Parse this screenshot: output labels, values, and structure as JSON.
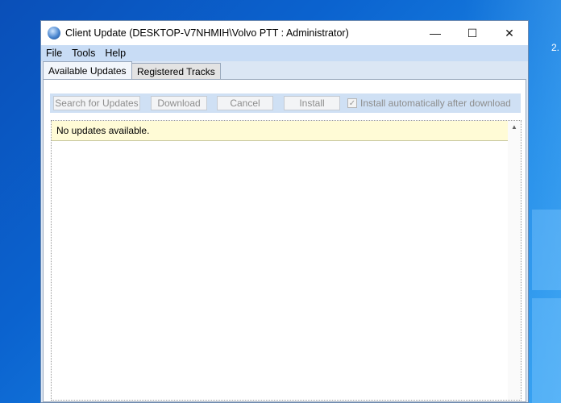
{
  "desktop": {
    "edge_text": "2."
  },
  "window": {
    "title": "Client Update (DESKTOP-V7NHMIH\\Volvo PTT : Administrator)",
    "icon": "globe-icon",
    "controls": {
      "minimize": "—",
      "maximize": "☐",
      "close": "✕"
    }
  },
  "menu": {
    "items": [
      "File",
      "Tools",
      "Help"
    ]
  },
  "tabs": [
    {
      "label": "Available Updates",
      "active": true
    },
    {
      "label": "Registered Tracks",
      "active": false
    }
  ],
  "toolbar": {
    "search_label": "Search for Updates",
    "download_label": "Download",
    "cancel_label": "Cancel",
    "install_label": "Install",
    "auto_install_label": "Install automatically after download",
    "auto_install_checked": true
  },
  "list": {
    "message": "No updates available."
  },
  "colors": {
    "desktop": "#0b63cf",
    "menubar": "#c8dcf5",
    "toolbar": "#cfe0f4",
    "list_row_bg": "#fffbd6"
  }
}
